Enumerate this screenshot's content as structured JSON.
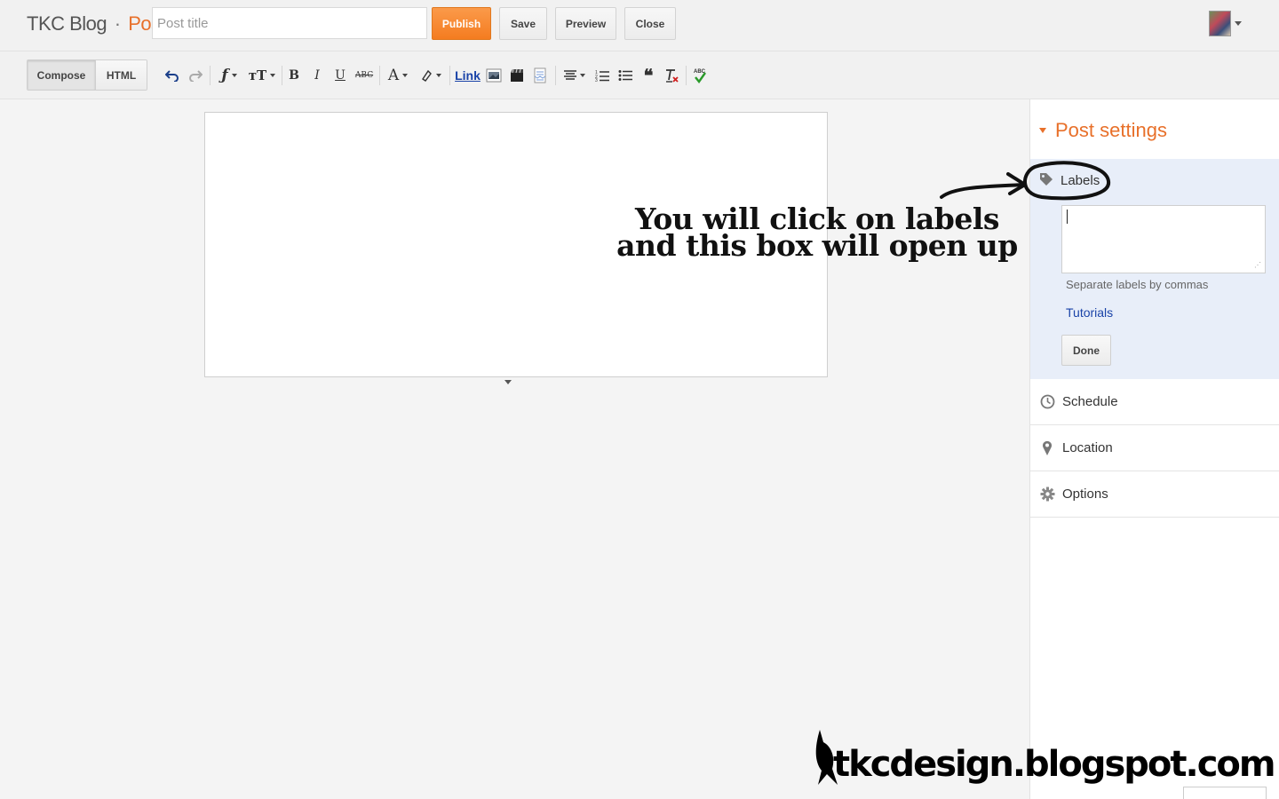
{
  "header": {
    "blog_name": "TKC Blog",
    "separator": "·",
    "section": "Post",
    "title_placeholder": "Post title",
    "publish_label": "Publish",
    "save_label": "Save",
    "preview_label": "Preview",
    "close_label": "Close"
  },
  "toolbar": {
    "compose_label": "Compose",
    "html_label": "HTML",
    "link_label": "Link",
    "icons": [
      "undo-icon",
      "redo-icon",
      "font-family-icon",
      "font-size-icon",
      "bold-icon",
      "italic-icon",
      "underline-icon",
      "strikethrough-icon",
      "text-color-icon",
      "highlight-icon",
      "link-icon",
      "image-icon",
      "video-icon",
      "jump-break-icon",
      "align-icon",
      "numbered-list-icon",
      "bullet-list-icon",
      "quote-icon",
      "clear-formatting-icon",
      "spellcheck-icon"
    ],
    "bold_glyph": "B",
    "italic_glyph": "I",
    "underline_glyph": "U",
    "strike_glyph": "ABC",
    "textcolor_glyph": "A",
    "quote_glyph": "❝"
  },
  "sidebar": {
    "title": "Post settings",
    "labels": {
      "label": "Labels",
      "hint": "Separate labels by commas",
      "suggestion": "Tutorials",
      "done_label": "Done"
    },
    "items": [
      {
        "label": "Schedule"
      },
      {
        "label": "Location"
      },
      {
        "label": "Options"
      }
    ]
  },
  "annotation": {
    "line1": "You will click on labels",
    "line2": "and this box will open up",
    "watermark": "tkcdesign.blogspot.com"
  },
  "colors": {
    "accent": "#e8702a",
    "link": "#1a43a8",
    "panel": "#e8eef9"
  }
}
